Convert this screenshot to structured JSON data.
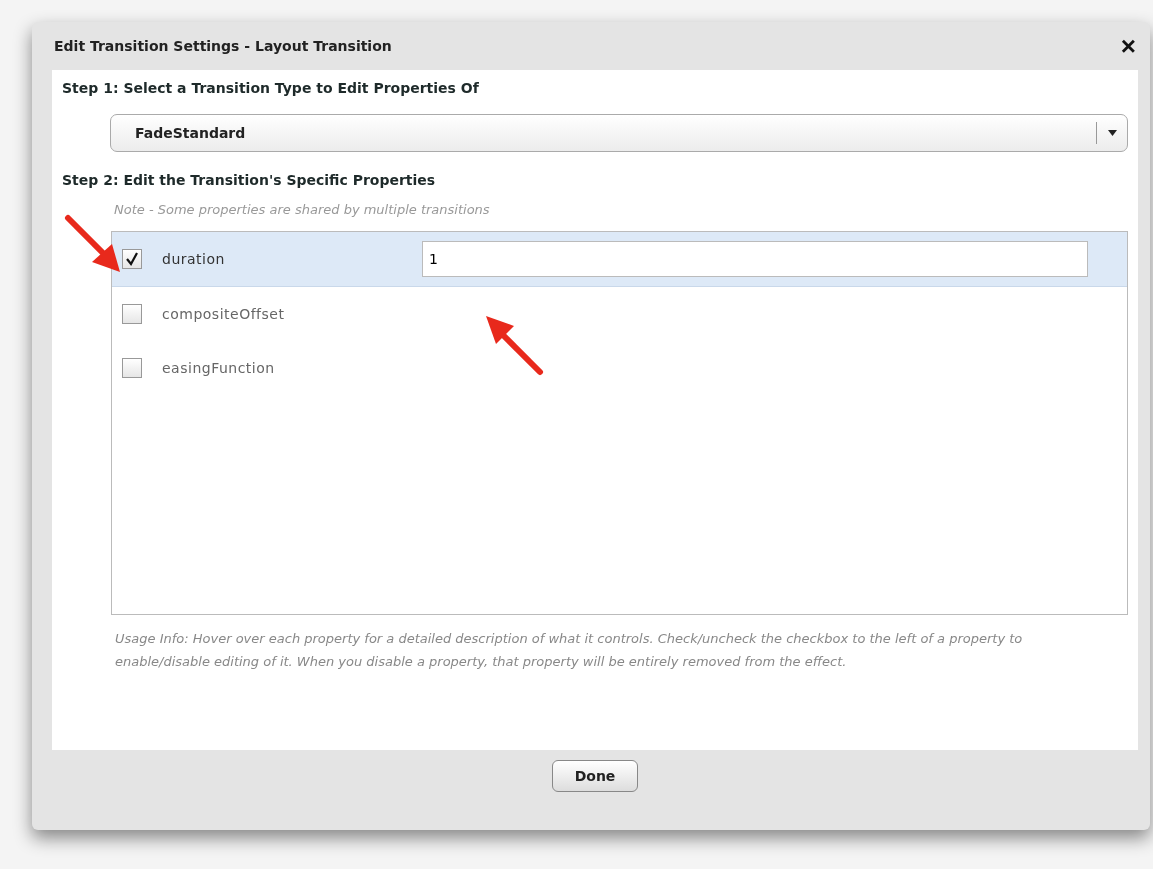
{
  "dialog": {
    "title": "Edit Transition Settings - Layout Transition",
    "close": "×"
  },
  "step1": {
    "heading": "Step 1: Select a Transition Type to Edit Properties Of",
    "dropdown": {
      "value": "FadeStandard"
    }
  },
  "step2": {
    "heading": "Step 2: Edit the Transition's Specific Properties",
    "note": "Note - Some properties are shared by multiple transitions"
  },
  "properties": [
    {
      "name": "duration",
      "checked": true,
      "value": "1"
    },
    {
      "name": "compositeOffset",
      "checked": false
    },
    {
      "name": "easingFunction",
      "checked": false
    }
  ],
  "usage_info": "Usage Info: Hover over each property for a detailed description of what it controls.  Check/uncheck the checkbox to the left of a property to enable/disable editing of it.  When you disable a property, that property will be entirely removed from the effect.",
  "buttons": [
    "Done"
  ]
}
